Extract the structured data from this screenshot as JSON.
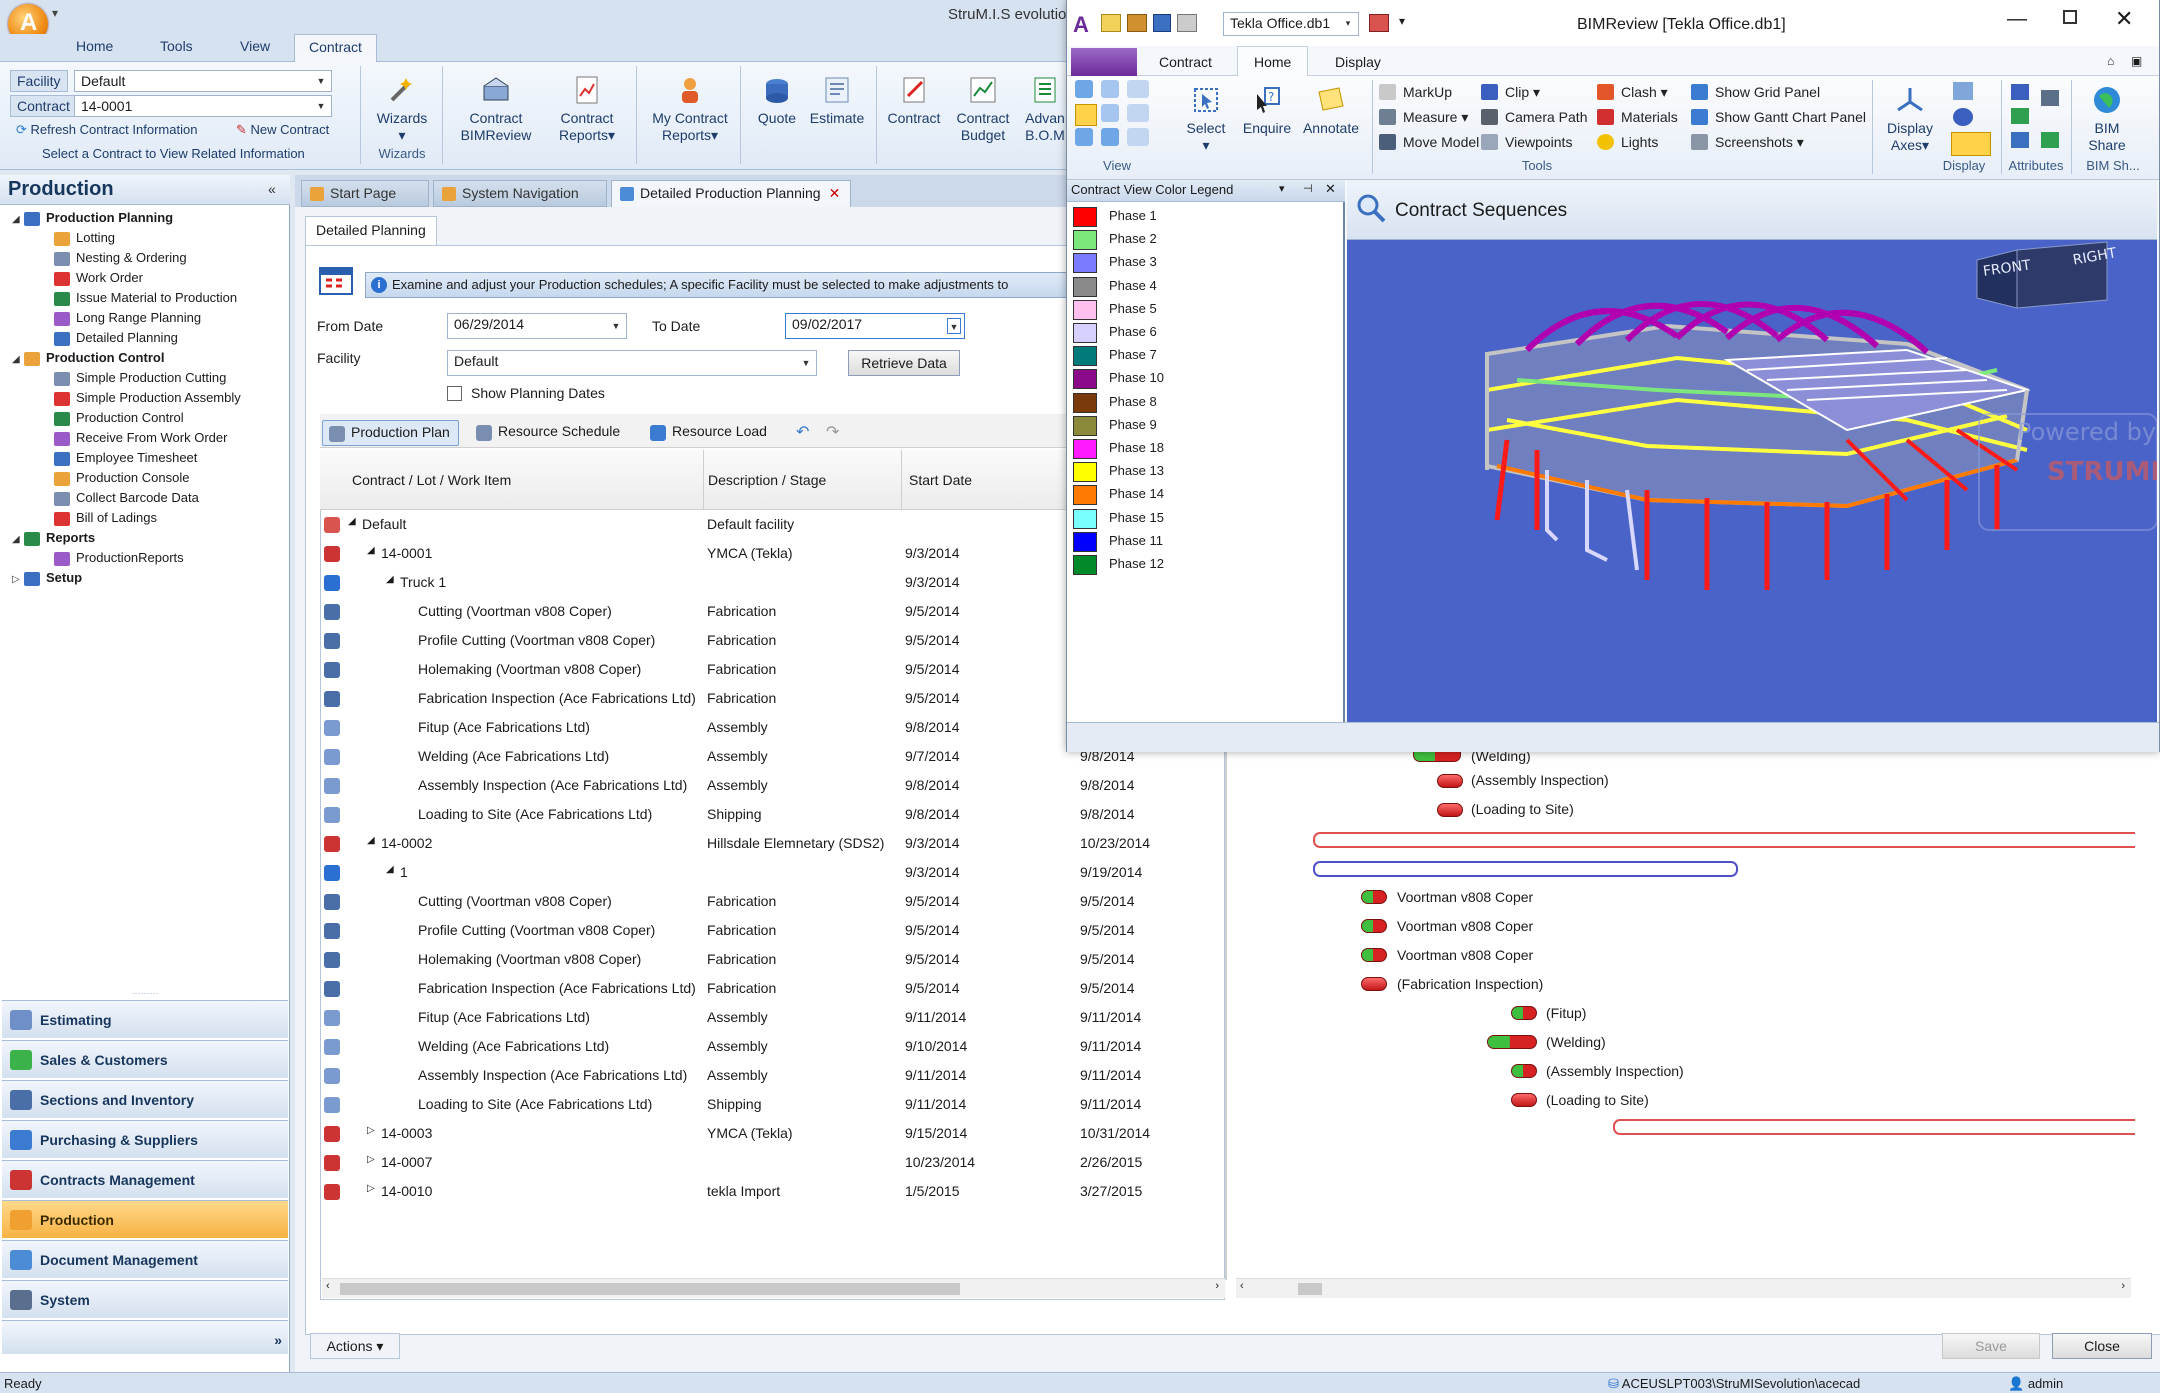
{
  "main": {
    "title": "StruM.I.S evolutio",
    "ribbon_tabs": [
      "Home",
      "Tools",
      "View",
      "Contract"
    ],
    "facility_label": "Facility",
    "facility_value": "Default",
    "contract_label": "Contract",
    "contract_value": "14-0001",
    "refresh_link": "Refresh Contract Information",
    "new_contract_link": "New Contract",
    "select_hint": "Select a Contract to View Related Information",
    "buttons": {
      "wizards": "Wizards",
      "contract_bimreview_1": "Contract",
      "contract_bimreview_2": "BIMReview",
      "contract_reports_1": "Contract",
      "contract_reports_2": "Reports",
      "my_contract_reports_1": "My Contract",
      "my_contract_reports_2": "Reports",
      "quote": "Quote",
      "estimate": "Estimate",
      "contract": "Contract",
      "contract_budget_1": "Contract",
      "contract_budget_2": "Budget",
      "advanced_1": "Advan",
      "advanced_2": "B.O.M"
    },
    "group_wizards": "Wizards"
  },
  "nav": {
    "header": "Production",
    "tree": [
      {
        "label": "Production Planning",
        "level": 0,
        "bold": true,
        "expand": "◢"
      },
      {
        "label": "Lotting",
        "level": 1
      },
      {
        "label": "Nesting & Ordering",
        "level": 1
      },
      {
        "label": "Work Order",
        "level": 1
      },
      {
        "label": "Issue Material to Production",
        "level": 1
      },
      {
        "label": "Long Range Planning",
        "level": 1
      },
      {
        "label": "Detailed Planning",
        "level": 1
      },
      {
        "label": "Production Control",
        "level": 0,
        "bold": true,
        "expand": "◢"
      },
      {
        "label": "Simple Production Cutting",
        "level": 1
      },
      {
        "label": "Simple Production Assembly",
        "level": 1
      },
      {
        "label": "Production Control",
        "level": 1
      },
      {
        "label": "Receive From Work Order",
        "level": 1
      },
      {
        "label": "Employee Timesheet",
        "level": 1
      },
      {
        "label": "Production Console",
        "level": 1
      },
      {
        "label": "Collect Barcode Data",
        "level": 1
      },
      {
        "label": "Bill of Ladings",
        "level": 1
      },
      {
        "label": "Reports",
        "level": 0,
        "bold": true,
        "expand": "◢"
      },
      {
        "label": "ProductionReports",
        "level": 1
      },
      {
        "label": "Setup",
        "level": 0,
        "bold": true,
        "expand": "▷"
      }
    ],
    "modules": [
      "Estimating",
      "Sales & Customers",
      "Sections and Inventory",
      "Purchasing & Suppliers",
      "Contracts Management",
      "Production",
      "Document Management",
      "System"
    ],
    "active_module": "Production"
  },
  "doctabs": [
    "Start Page",
    "System Navigation",
    "Detailed Production Planning"
  ],
  "detail": {
    "subtab": "Detailed Planning",
    "info": "Examine and adjust your Production schedules; A specific Facility must be selected to make adjustments to",
    "from_label": "From Date",
    "from_value": "06/29/2014",
    "to_label": "To Date",
    "to_value": "09/02/2017",
    "facility_label": "Facility",
    "facility_value": "Default",
    "retrieve": "Retrieve Data",
    "show_dates": "Show Planning Dates",
    "tools": [
      "Production Plan",
      "Resource Schedule",
      "Resource Load"
    ],
    "columns": [
      "Contract / Lot / Work Item",
      "Description / Stage",
      "Start Date"
    ],
    "rows": [
      {
        "indent": 0,
        "expand": "◢",
        "c1": "Default",
        "c2": "Default facility",
        "c3": "",
        "c4": "",
        "icon": "facility"
      },
      {
        "indent": 1,
        "expand": "◢",
        "c1": "14-0001",
        "c2": "YMCA (Tekla)",
        "c3": "9/3/2014",
        "c4": "",
        "icon": "contract"
      },
      {
        "indent": 2,
        "expand": "◢",
        "c1": "Truck 1",
        "c2": "",
        "c3": "9/3/2014",
        "c4": "",
        "icon": "lot"
      },
      {
        "indent": 3,
        "c1": "Cutting (Voortman v808 Coper)",
        "c2": "Fabrication",
        "c3": "9/5/2014",
        "c4": "",
        "icon": "item"
      },
      {
        "indent": 3,
        "c1": "Profile Cutting (Voortman v808 Coper)",
        "c2": "Fabrication",
        "c3": "9/5/2014",
        "c4": "",
        "icon": "item"
      },
      {
        "indent": 3,
        "c1": "Holemaking (Voortman v808 Coper)",
        "c2": "Fabrication",
        "c3": "9/5/2014",
        "c4": "",
        "icon": "item"
      },
      {
        "indent": 3,
        "c1": "Fabrication Inspection (Ace Fabrications Ltd)",
        "c2": "Fabrication",
        "c3": "9/5/2014",
        "c4": "",
        "icon": "item"
      },
      {
        "indent": 3,
        "c1": "Fitup (Ace Fabrications Ltd)",
        "c2": "Assembly",
        "c3": "9/8/2014",
        "c4": "",
        "icon": "assy"
      },
      {
        "indent": 3,
        "c1": "Welding (Ace Fabrications Ltd)",
        "c2": "Assembly",
        "c3": "9/7/2014",
        "c4": "9/8/2014",
        "icon": "assy"
      },
      {
        "indent": 3,
        "c1": "Assembly Inspection (Ace Fabrications Ltd)",
        "c2": "Assembly",
        "c3": "9/8/2014",
        "c4": "9/8/2014",
        "icon": "assy"
      },
      {
        "indent": 3,
        "c1": "Loading to Site (Ace Fabrications Ltd)",
        "c2": "Shipping",
        "c3": "9/8/2014",
        "c4": "9/8/2014",
        "icon": "assy"
      },
      {
        "indent": 1,
        "expand": "◢",
        "c1": "14-0002",
        "c2": "Hillsdale Elemnetary (SDS2)",
        "c3": "9/3/2014",
        "c4": "10/23/2014",
        "icon": "contract"
      },
      {
        "indent": 2,
        "expand": "◢",
        "c1": "1",
        "c2": "",
        "c3": "9/3/2014",
        "c4": "9/19/2014",
        "icon": "lot"
      },
      {
        "indent": 3,
        "c1": "Cutting (Voortman v808 Coper)",
        "c2": "Fabrication",
        "c3": "9/5/2014",
        "c4": "9/5/2014",
        "icon": "item"
      },
      {
        "indent": 3,
        "c1": "Profile Cutting (Voortman v808 Coper)",
        "c2": "Fabrication",
        "c3": "9/5/2014",
        "c4": "9/5/2014",
        "icon": "item"
      },
      {
        "indent": 3,
        "c1": "Holemaking (Voortman v808 Coper)",
        "c2": "Fabrication",
        "c3": "9/5/2014",
        "c4": "9/5/2014",
        "icon": "item"
      },
      {
        "indent": 3,
        "c1": "Fabrication Inspection (Ace Fabrications Ltd)",
        "c2": "Fabrication",
        "c3": "9/5/2014",
        "c4": "9/5/2014",
        "icon": "item"
      },
      {
        "indent": 3,
        "c1": "Fitup (Ace Fabrications Ltd)",
        "c2": "Assembly",
        "c3": "9/11/2014",
        "c4": "9/11/2014",
        "icon": "assy"
      },
      {
        "indent": 3,
        "c1": "Welding (Ace Fabrications Ltd)",
        "c2": "Assembly",
        "c3": "9/10/2014",
        "c4": "9/11/2014",
        "icon": "assy"
      },
      {
        "indent": 3,
        "c1": "Assembly Inspection (Ace Fabrications Ltd)",
        "c2": "Assembly",
        "c3": "9/11/2014",
        "c4": "9/11/2014",
        "icon": "assy"
      },
      {
        "indent": 3,
        "c1": "Loading to Site (Ace Fabrications Ltd)",
        "c2": "Shipping",
        "c3": "9/11/2014",
        "c4": "9/11/2014",
        "icon": "assy"
      },
      {
        "indent": 1,
        "expand": "▷",
        "c1": "14-0003",
        "c2": "YMCA (Tekla)",
        "c3": "9/15/2014",
        "c4": "10/31/2014",
        "icon": "contract"
      },
      {
        "indent": 1,
        "expand": "▷",
        "c1": "14-0007",
        "c2": "",
        "c3": "10/23/2014",
        "c4": "2/26/2015",
        "icon": "contract"
      },
      {
        "indent": 1,
        "expand": "▷",
        "c1": "14-0010",
        "c2": "tekla Import",
        "c3": "1/5/2015",
        "c4": "3/27/2015",
        "icon": "contract"
      }
    ],
    "gantt_labels": {
      "welding1": "(Welding)",
      "assy1": "(Assembly Inspection)",
      "load1": "(Loading to Site)",
      "v1": "Voortman v808 Coper",
      "v2": "Voortman v808 Coper",
      "v3": "Voortman v808 Coper",
      "fabinsp": "(Fabrication Inspection)",
      "fitup": "(Fitup)",
      "welding2": "(Welding)",
      "assy2": "(Assembly Inspection)",
      "load2": "(Loading to Site)"
    },
    "actions": "Actions",
    "save": "Save",
    "close": "Close"
  },
  "status": {
    "left": "Ready",
    "path": "ACEUSLPT003\\StruMISevolution\\acecad",
    "user": "admin"
  },
  "bim": {
    "title": "BIMReview [Tekla Office.db1]",
    "file_combo": "Tekla Office.db1",
    "tabs": [
      "Contract",
      "Home",
      "Display"
    ],
    "active_tab": "Home",
    "select": "Select",
    "enquire": "Enquire",
    "annotate": "Annotate",
    "view_group": "View",
    "tools_items": [
      "MarkUp",
      "Measure",
      "Move Model",
      "Clip",
      "Camera Path",
      "Viewpoints",
      "Clash",
      "Materials",
      "Lights",
      "Show Grid Panel",
      "Show Gantt Chart Panel",
      "Screenshots"
    ],
    "tools_group": "Tools",
    "display_axes_1": "Display",
    "display_axes_2": "Axes",
    "display_group": "Display",
    "attributes_group": "Attributes",
    "bim_share_1": "BIM",
    "bim_share_2": "Share",
    "bim_share_group": "BIM Sh...",
    "legend_title": "Contract View Color Legend",
    "phases": [
      {
        "name": "Phase 1",
        "color": "#ff0000"
      },
      {
        "name": "Phase 2",
        "color": "#7ce87c"
      },
      {
        "name": "Phase 3",
        "color": "#7b7bff"
      },
      {
        "name": "Phase 4",
        "color": "#8a8a8a"
      },
      {
        "name": "Phase 5",
        "color": "#ffc0f0"
      },
      {
        "name": "Phase 6",
        "color": "#d6d0ff"
      },
      {
        "name": "Phase 7",
        "color": "#007a7a"
      },
      {
        "name": "Phase 10",
        "color": "#8a0a8a"
      },
      {
        "name": "Phase 8",
        "color": "#7a3a0a"
      },
      {
        "name": "Phase 9",
        "color": "#8a8a3a"
      },
      {
        "name": "Phase 18",
        "color": "#ff1aff"
      },
      {
        "name": "Phase 13",
        "color": "#ffff00"
      },
      {
        "name": "Phase 14",
        "color": "#ff7a00"
      },
      {
        "name": "Phase 15",
        "color": "#7affff"
      },
      {
        "name": "Phase 11",
        "color": "#0000ff"
      },
      {
        "name": "Phase 12",
        "color": "#008a2a"
      }
    ],
    "seq_title": "Contract Sequences",
    "cube_front": "FRONT",
    "cube_right": "RIGHT",
    "watermark_1": "Powered by",
    "watermark_2": "STRUMIS"
  },
  "colors": {
    "accent": "#f7b243",
    "ribbon": "#d6e2f0",
    "viewport": "#4a63c9"
  }
}
